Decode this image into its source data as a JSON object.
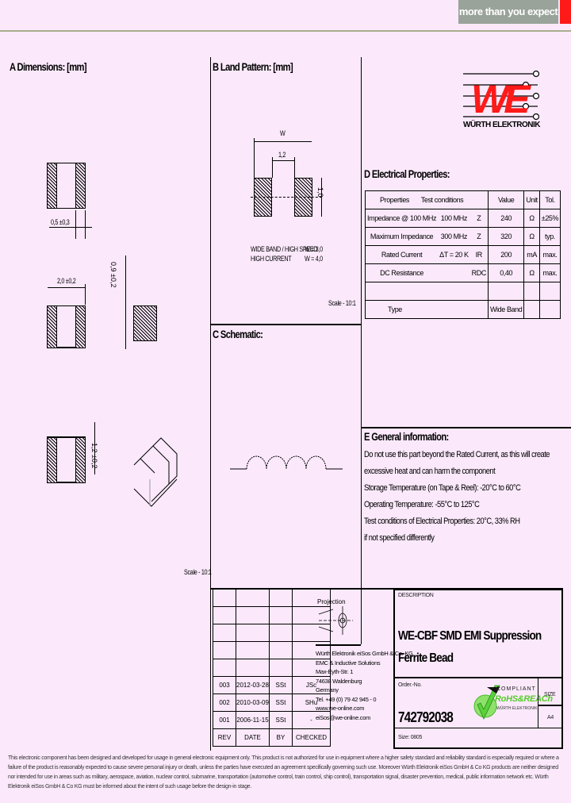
{
  "banner": {
    "slogan": "more than you expect"
  },
  "logo": {
    "brand": "WÜRTH ELEKTRONIK",
    "mark": "WE"
  },
  "sections": {
    "dimensions": {
      "title": "A Dimensions: [mm]",
      "dim_terminal": "0,5 ±0,3",
      "dim_length": "2,0 ±0,2",
      "dim_height": "0,9 ±0,2",
      "dim_width": "1,2 ±0,2",
      "scale": "Scale - 10:1"
    },
    "land_pattern": {
      "title": "B Land Pattern: [mm]",
      "dim_w": "W",
      "dim_gap": "1,2",
      "dim_h": "1,0",
      "note_wide": "WIDE BAND / HIGH SPEED",
      "note_wide_val": "W = 3,0",
      "note_high": "HIGH CURRENT",
      "note_high_val": "W = 4,0",
      "scale": "Scale - 10:1"
    },
    "schematic": {
      "title": "C Schematic:"
    },
    "electrical": {
      "title": "D Electrical Properties:",
      "headers": [
        "Properties",
        "Test conditions",
        "",
        "Value",
        "Unit",
        "Tol."
      ],
      "rows": [
        [
          "Impedance @ 100 MHz",
          "100 MHz",
          "Z",
          "240",
          "Ω",
          "±25%"
        ],
        [
          "Maximum Impedance",
          "300 MHz",
          "Z",
          "320",
          "Ω",
          "typ."
        ],
        [
          "Rated Current",
          "ΔT = 20 K",
          "IR",
          "200",
          "mA",
          "max."
        ],
        [
          "DC Resistance",
          "",
          "RDC",
          "0,40",
          "Ω",
          "max."
        ],
        [
          "",
          "",
          "",
          "",
          "",
          ""
        ],
        [
          "Type",
          "",
          "",
          "Wide Band",
          "",
          ""
        ]
      ]
    },
    "general": {
      "title": "E General information:",
      "lines": [
        "Do not use this part beyond the Rated Current, as this will create",
        "excessive heat and can harm the component",
        "Storage Temperature (on Tape & Reel): -20°C to 60°C",
        "Operating Temperature: -55°C to 125°C",
        "Test conditions of Electrical Properties: 20°C, 33% RH",
        "if not specified differently"
      ]
    }
  },
  "title_block": {
    "projection_label": "Projection",
    "revisions": [
      [
        "003",
        "2012-03-28",
        "SSt",
        "JSc"
      ],
      [
        "002",
        "2010-03-09",
        "SSt",
        "SHu"
      ],
      [
        "001",
        "2006-11-15",
        "SSt",
        "-"
      ]
    ],
    "rev_headers": [
      "REV",
      "DATE",
      "BY",
      "CHECKED"
    ],
    "company_lines": [
      "Würth Elektronik eiSos GmbH & Co. KG",
      "EMC & Inductive Solutions",
      "Max-Eyth-Str. 1",
      "74638 Waldenburg",
      "Germany",
      "Tel. +49 (0) 79 42 945 - 0",
      "www.we-online.com",
      "eiSos@we-online.com"
    ],
    "description_label": "DESCRIPTION",
    "description": "WE-CBF SMD EMI Suppression Ferrite Bead",
    "order_label": "Order.-No.",
    "order_no": "742792038",
    "size_label": "SIZE",
    "size_value": "A4",
    "case_label": "Size: 0805",
    "compliance": {
      "line1": "COMPLIANT",
      "line2": "RoHS&REACh",
      "line3": "WÜRTH ELEKTRONIK"
    }
  },
  "footer": {
    "text": "This electronic component has been designed and developed for usage in general electronic equipment only. This product is not authorized for use in equipment where a higher safety standard and reliability standard is especially required or where a failure of the product is reasonably expected to cause severe personal injury or death, unless the parties have executed an agreement specifically governing such use. Moreover Würth Elektronik eiSos GmbH & Co KG products are neither designed nor intended for use in areas such as military, aerospace, aviation, nuclear control, submarine, transportation (automotive control, train control, ship control), transportation signal, disaster prevention, medical, public information network etc. Würth Elektronik eiSos GmbH & Co KG must be informed about the intent of such usage before the design-in stage."
  }
}
